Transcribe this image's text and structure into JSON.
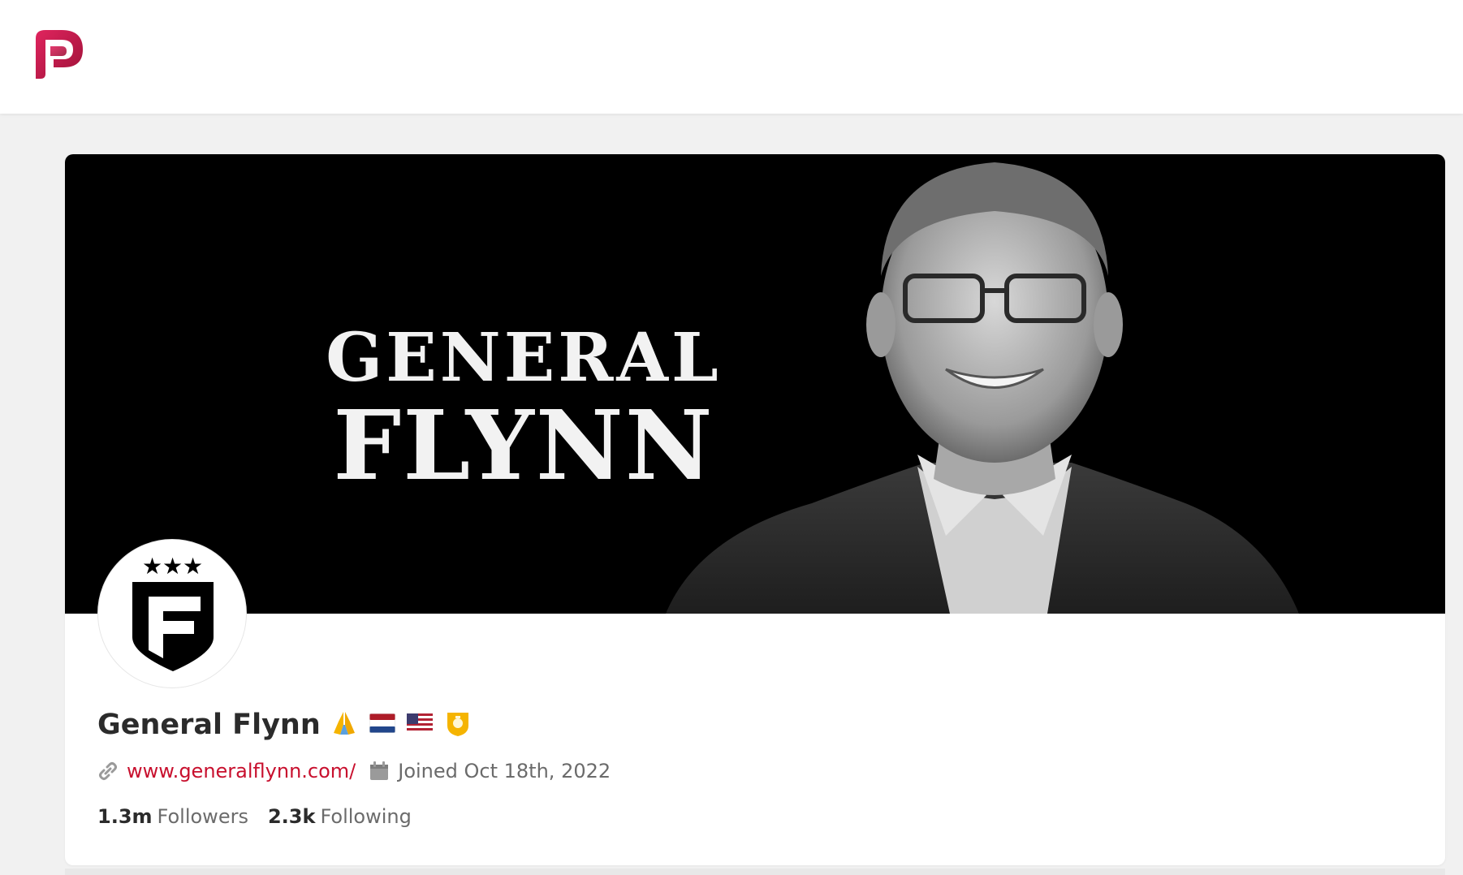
{
  "app": {
    "brand_color": "#c8102e",
    "logo_icon": "parler-logo-icon"
  },
  "profile": {
    "banner": {
      "line1": "GENERAL",
      "line2": "FLYNN"
    },
    "avatar_icon": "flynn-shield-logo-icon",
    "display_name": "General Flynn",
    "badges": [
      {
        "icon": "praying-hands-emoji",
        "glyph": "🙏"
      },
      {
        "icon": "netherlands-flag-icon"
      },
      {
        "icon": "usa-flag-icon"
      },
      {
        "icon": "verified-badge-icon"
      }
    ],
    "website": "www.generalflynn.com/",
    "joined": "Joined Oct 18th, 2022",
    "followers_count": "1.3m",
    "followers_label": "Followers",
    "following_count": "2.3k",
    "following_label": "Following"
  }
}
